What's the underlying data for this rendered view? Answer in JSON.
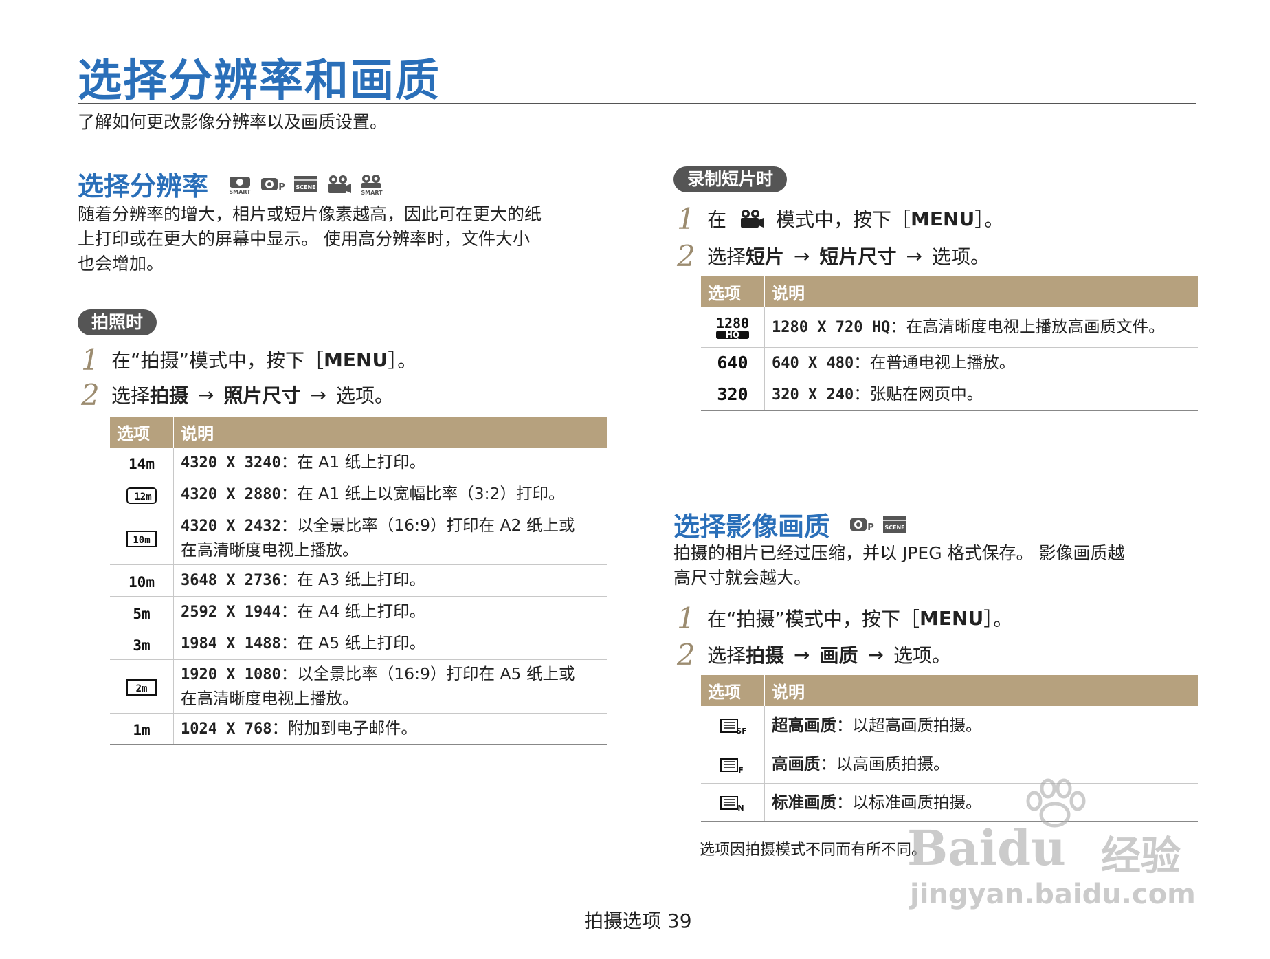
{
  "page": {
    "title": "选择分辨率和画质",
    "subtitle": "了解如何更改影像分辨率以及画质设置。",
    "footer": "拍摄选项  39"
  },
  "resolution_section": {
    "title": "选择分辨率",
    "mode_icons": [
      "smart-auto-icon",
      "program-icon",
      "scene-icon",
      "movie-icon",
      "smart-movie-icon"
    ],
    "paragraph": [
      "随着分辨率的增大，相片或短片像素越高，因此可在更大的纸",
      "上打印或在更大的屏幕中显示。 使用高分辨率时，文件大小",
      "也会增加。"
    ],
    "photo_pill": "拍照时",
    "step1": {
      "num": "1",
      "pre": "在“拍摄”模式中，按下［",
      "key": "MENU",
      "post": "］。"
    },
    "step2": {
      "num": "2",
      "pre": "选择",
      "item1": "拍摄",
      "arrow": "→",
      "item2": "照片尺寸",
      "post": "选项。"
    },
    "table": {
      "headers": [
        "选项",
        "说明"
      ],
      "rows": [
        {
          "icon": "14m",
          "res": "4320 X 3240",
          "desc": "：在 A1 纸上打印。"
        },
        {
          "icon": "12m-wide",
          "res": "4320 X 2880",
          "desc": "：在 A1 纸上以宽幅比率（3:2）打印。"
        },
        {
          "icon": "10m-wide",
          "res": "4320 X 2432",
          "desc": "：以全景比率（16:9）打印在 A2 纸上或",
          "desc2": "在高清晰度电视上播放。"
        },
        {
          "icon": "10m",
          "res": "3648 X 2736",
          "desc": "：在 A3 纸上打印。"
        },
        {
          "icon": "5m",
          "res": "2592 X 1944",
          "desc": "：在 A4 纸上打印。"
        },
        {
          "icon": "3m",
          "res": "1984 X 1488",
          "desc": "：在 A5 纸上打印。"
        },
        {
          "icon": "2m-wide",
          "res": "1920 X 1080",
          "desc": "：以全景比率（16:9）打印在 A5 纸上或",
          "desc2": "在高清晰度电视上播放。"
        },
        {
          "icon": "1m",
          "res": "1024 X 768",
          "desc": "：附加到电子邮件。"
        }
      ]
    }
  },
  "movie_section": {
    "pill": "录制短片时",
    "step1": {
      "num": "1",
      "pre": "在",
      "mid": "模式中，按下［",
      "key": "MENU",
      "post": "］。"
    },
    "step2": {
      "num": "2",
      "pre": "选择",
      "item1": "短片",
      "arrow": "→",
      "item2": "短片尺寸",
      "post": "选项。"
    },
    "table": {
      "headers": [
        "选项",
        "说明"
      ],
      "rows": [
        {
          "icon": "1280-hq",
          "icon_top": "1280",
          "icon_bottom": "HQ",
          "res": "1280 X 720 HQ",
          "desc": "：在高清晰度电视上播放高画质文件。"
        },
        {
          "icon": "640",
          "icon_text": "640",
          "res": "640 X 480",
          "desc": "：在普通电视上播放。"
        },
        {
          "icon": "320",
          "icon_text": "320",
          "res": "320 X 240",
          "desc": "：张贴在网页中。"
        }
      ]
    }
  },
  "quality_section": {
    "title": "选择影像画质",
    "mode_icons": [
      "program-icon",
      "scene-icon"
    ],
    "paragraph": [
      "拍摄的相片已经过压缩，并以 JPEG 格式保存。 影像画质越",
      "高尺寸就会越大。"
    ],
    "step1": {
      "num": "1",
      "pre": "在“拍摄”模式中，按下［",
      "key": "MENU",
      "post": "］。"
    },
    "step2": {
      "num": "2",
      "pre": "选择",
      "item1": "拍摄",
      "arrow": "→",
      "item2": "画质",
      "post": "选项。"
    },
    "table": {
      "headers": [
        "选项",
        "说明"
      ],
      "rows": [
        {
          "icon": "super-fine-icon",
          "label": "超高画质",
          "desc": "：以超高画质拍摄。"
        },
        {
          "icon": "fine-icon",
          "label": "高画质",
          "desc": "：以高画质拍摄。"
        },
        {
          "icon": "normal-icon",
          "label": "标准画质",
          "desc": "：以标准画质拍摄。"
        }
      ]
    },
    "note": "选项因拍摄模式不同而有所不同。"
  },
  "watermark": {
    "brand": "Baidu",
    "cn": "经验",
    "url": "jingyan.baidu.com"
  },
  "colors": {
    "title_blue": "#2a6fb9",
    "table_header": "#b6a17e",
    "pill_bg": "#555555",
    "step_number": "#9c8c70"
  }
}
